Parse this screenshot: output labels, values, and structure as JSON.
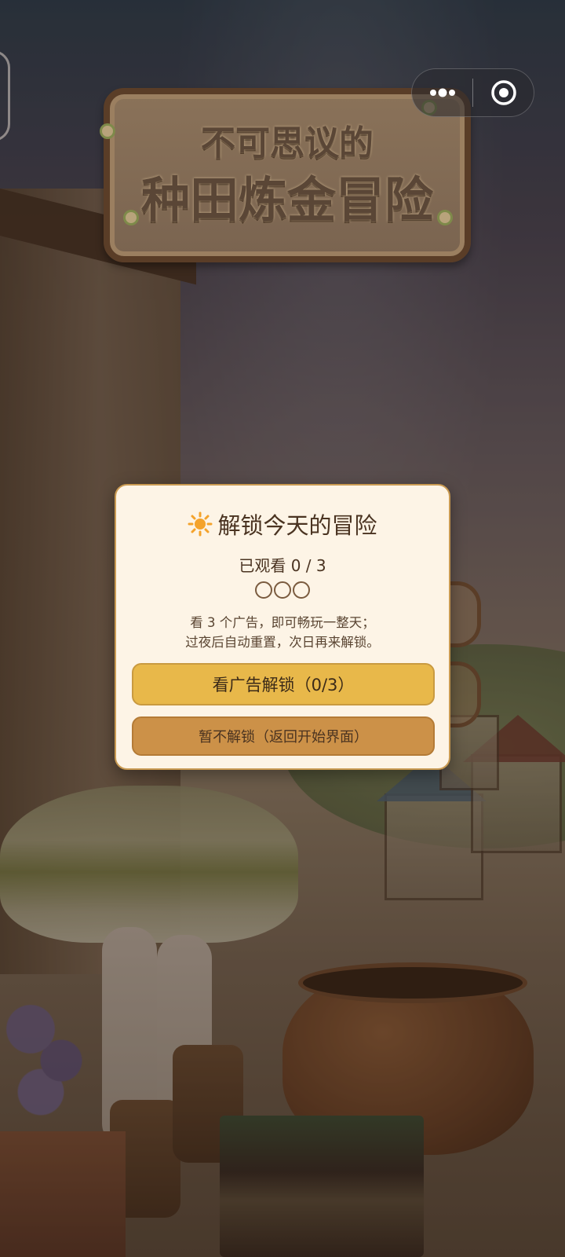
{
  "header": {
    "title_line1": "不可思议的",
    "title_line2": "种田炼金冒险"
  },
  "capsule": {
    "more_icon": "more-dots-icon",
    "close_icon": "target-circle-icon"
  },
  "modal": {
    "title": "解锁今天的冒险",
    "title_icon": "sun-icon",
    "progress_text": "已观看 0 / 3",
    "progress_watched": 0,
    "progress_total": 3,
    "desc_line1": "看 3 个广告，即可畅玩一整天；",
    "desc_line2": "过夜后自动重置，次日再来解锁。",
    "primary_label": "看广告解锁（0/3）",
    "secondary_label": "暂不解锁（返回开始界面）"
  },
  "colors": {
    "modal_bg": "#fdf4e6",
    "modal_border": "#c99a52",
    "primary_btn": "#e8b84a",
    "secondary_btn": "#cc9148",
    "sun": "#f4a32c"
  }
}
